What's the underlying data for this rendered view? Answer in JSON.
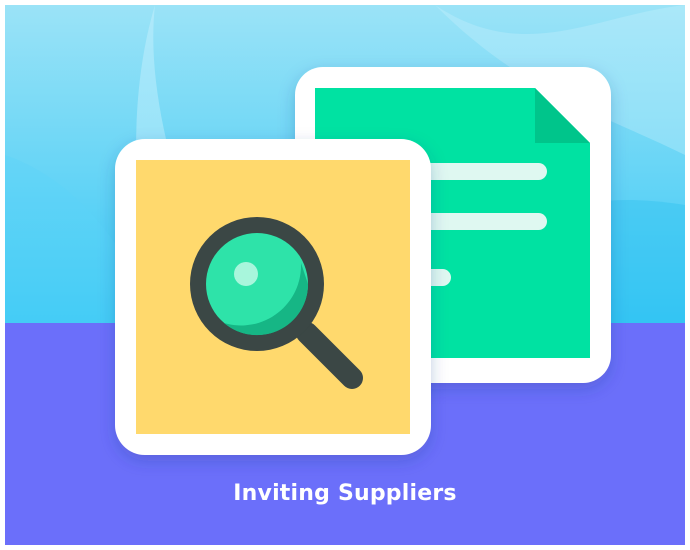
{
  "title": "Inviting Suppliers",
  "icons": {
    "document": "document-icon",
    "magnifier": "magnifier-icon"
  },
  "colors": {
    "sky_top": "#9be3f7",
    "sky_bottom": "#38c8f5",
    "floor": "#6b6ffa",
    "document": "#05e2a2",
    "document_fold": "#02c58b",
    "search_card": "#ffd96d",
    "magnifier_ring": "#3a4644",
    "magnifier_lens": "#2fe3a9",
    "caption": "#ffffff"
  }
}
